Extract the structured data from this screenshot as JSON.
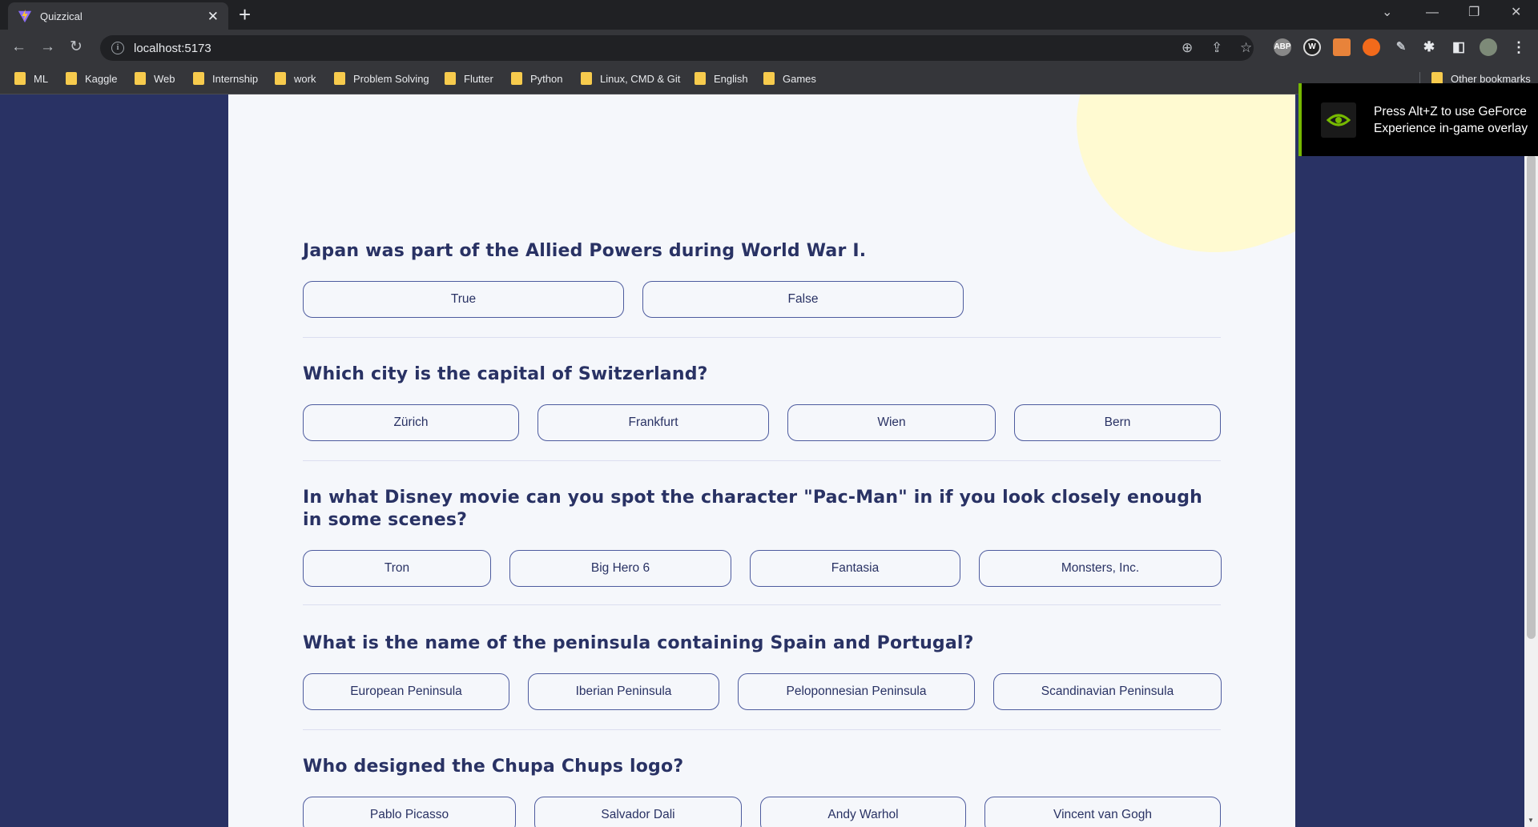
{
  "browser": {
    "tab_title": "Quizzical",
    "url": "localhost:5173",
    "bookmarks": [
      "ML",
      "Kaggle",
      "Web",
      "Internship",
      "work",
      "Problem Solving",
      "Flutter",
      "Python",
      "Linux, CMD & Git",
      "English",
      "Games"
    ],
    "other_bookmarks": "Other bookmarks",
    "extensions": {
      "abp": "ABP",
      "w": "W"
    }
  },
  "overlay": {
    "text": "Press Alt+Z to use GeForce Experience in-game overlay"
  },
  "quiz": {
    "questions": [
      {
        "text": "Japan was part of the Allied Powers during World War I.",
        "answers": [
          "True",
          "False"
        ]
      },
      {
        "text": "Which city is the capital of Switzerland?",
        "answers": [
          "Zürich",
          "Frankfurt",
          "Wien",
          "Bern"
        ]
      },
      {
        "text": "In what Disney movie can you spot the character \"Pac-Man\" in if you look closely enough in some scenes?",
        "answers": [
          "Tron",
          "Big Hero 6",
          "Fantasia",
          "Monsters, Inc."
        ]
      },
      {
        "text": "What is the name of the peninsula containing Spain and Portugal?",
        "answers": [
          "European Peninsula",
          "Iberian Peninsula",
          "Peloponnesian Peninsula",
          "Scandinavian Peninsula"
        ]
      },
      {
        "text": "Who designed the Chupa Chups logo?",
        "answers": [
          "Pablo Picasso",
          "Salvador Dali",
          "Andy Warhol",
          "Vincent van Gogh"
        ]
      }
    ]
  },
  "colors": {
    "page_bg": "#293264",
    "card_bg": "#f5f7fb",
    "text": "#293264",
    "button_border": "#4d5b9e",
    "blob": "#fffad1",
    "nvidia_green": "#76b900"
  }
}
